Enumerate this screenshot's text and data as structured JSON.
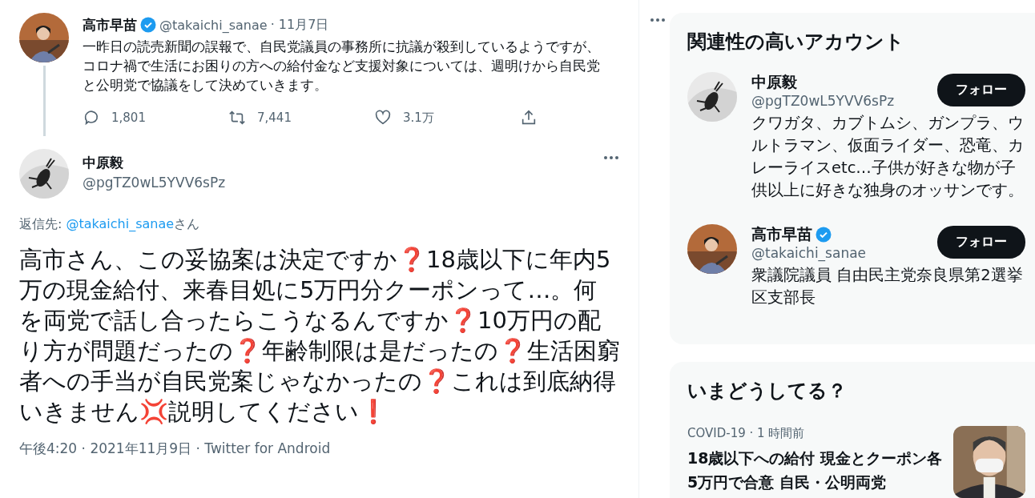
{
  "thread": [
    {
      "kind": "parent",
      "name": "高市早苗",
      "verified": true,
      "handle": "@takaichi_sanae",
      "date": "· 11月7日",
      "text": "一昨日の読売新聞の誤報で、自民党議員の事務所に抗議が殺到しているようですが、コロナ禍で生活にお困りの方への給付金など支援対象については、週明けから自民党と公明党で協議をして決めていきます。",
      "actions": [
        {
          "kind": "reply",
          "count": "1,801"
        },
        {
          "kind": "retweet",
          "count": "7,441"
        },
        {
          "kind": "like",
          "count": "3.1万"
        },
        {
          "kind": "share"
        }
      ]
    },
    {
      "kind": "focus",
      "name": "中原毅",
      "verified": false,
      "handle": "@pgTZ0wL5YVV6sPz",
      "reply_label": "返信先:",
      "reply_to": "@takaichi_sanae",
      "reply_suffix": "さん",
      "text": "高市さん、この妥協案は決定ですか❓18歳以下に年内5万の現金給付、来春目処に5万円分クーポンって…。何を両党で話し合ったらこうなるんですか❓10万円の配り方が問題だったの❓年齢制限は是だったの❓生活困窮者への手当が自民党案じゃなかったの❓これは到底納得いきません💢説明してください❗",
      "footer": "午後4:20 · 2021年11月9日 · Twitter for Android"
    }
  ],
  "related": {
    "title": "関連性の高いアカウント",
    "accounts": [
      {
        "name": "中原毅",
        "verified": false,
        "handle": "@pgTZ0wL5YVV6sPz",
        "follow": "フォロー",
        "bio": "クワガタ、カブトムシ、ガンプラ、ウルトラマン、仮面ライダー、恐竜、カレーライスetc…子供が好きな物が子供以上に好きな独身のオッサンです。"
      },
      {
        "name": "高市早苗",
        "verified": true,
        "handle": "@takaichi_sanae",
        "follow": "フォロー",
        "bio": "衆議院議員 自由民主党奈良県第2選挙区支部長"
      }
    ]
  },
  "trends": {
    "title": "いまどうしてる？",
    "items": [
      {
        "meta": "COVID-19 · 1 時間前",
        "headline": "18歳以下への給付 現金とクーポン各5万円で合意 自民・公明両党"
      }
    ]
  }
}
